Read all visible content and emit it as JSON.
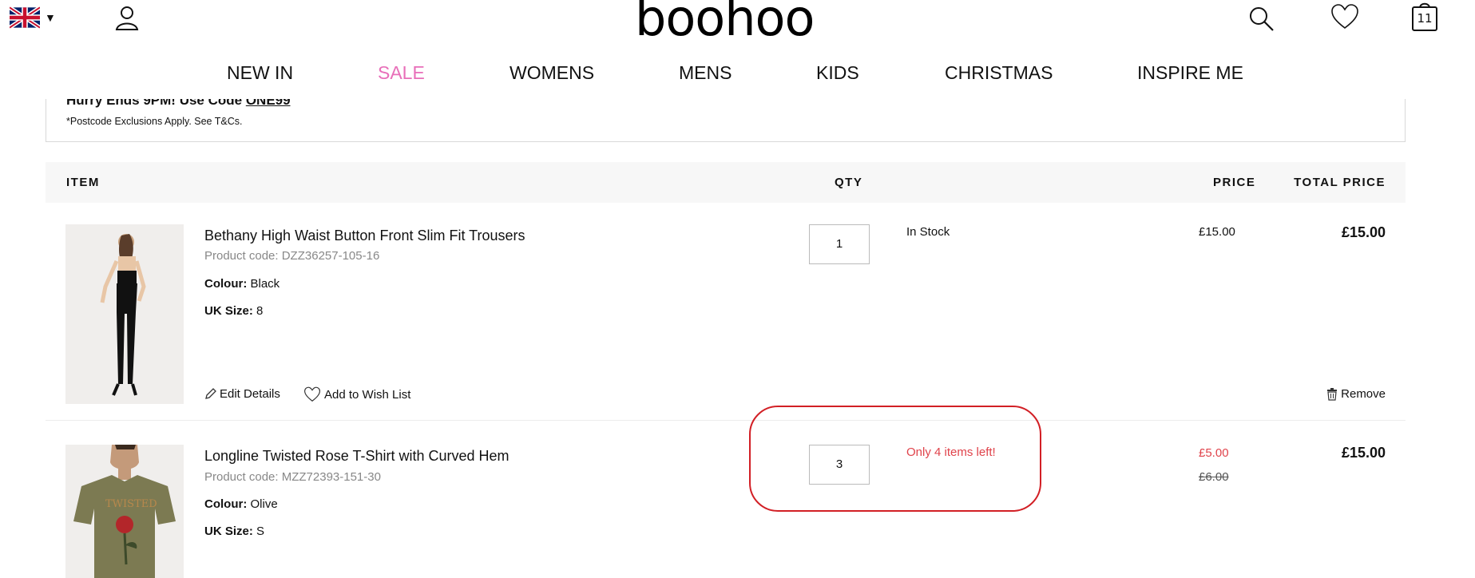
{
  "header": {
    "logo": "boohoo",
    "bag_count": "11",
    "icons": {
      "flag": "uk-flag-icon",
      "account": "account-icon",
      "search": "search-icon",
      "wishlist": "heart-icon",
      "bag": "shopping-bag-icon"
    }
  },
  "nav": [
    "NEW IN",
    "SALE",
    "WOMENS",
    "MENS",
    "KIDS",
    "CHRISTMAS",
    "INSPIRE ME"
  ],
  "promo": {
    "headline_prefix": "Hurry Ends 9PM! Use Code ",
    "code": "ONE99",
    "note": "*Postcode Exclusions Apply. See T&Cs."
  },
  "table_header": {
    "item": "ITEM",
    "qty": "QTY",
    "price": "PRICE",
    "total": "TOTAL PRICE"
  },
  "items": [
    {
      "name": "Bethany High Waist Button Front Slim Fit Trousers",
      "code": "Product code: DZZ36257-105-16",
      "colour_label": "Colour:",
      "colour": "Black",
      "size_label": "UK Size:",
      "size": "8",
      "qty": "1",
      "stock": "In Stock",
      "price": "£15.00",
      "total": "£15.00",
      "edit_label": "Edit Details",
      "wishlist_label": "Add to Wish List",
      "remove_label": "Remove"
    },
    {
      "name": "Longline Twisted Rose T-Shirt with Curved Hem",
      "code": "Product code: MZZ72393-151-30",
      "colour_label": "Colour:",
      "colour": "Olive",
      "size_label": "UK Size:",
      "size": "S",
      "qty": "3",
      "stock": "Only 4 items left!",
      "price": "£5.00",
      "price_was": "£6.00",
      "total": "£15.00"
    }
  ],
  "colors": {
    "sale_pink": "#e86fb9",
    "warning_red": "#e0434b",
    "highlight_red": "#d21f25"
  }
}
